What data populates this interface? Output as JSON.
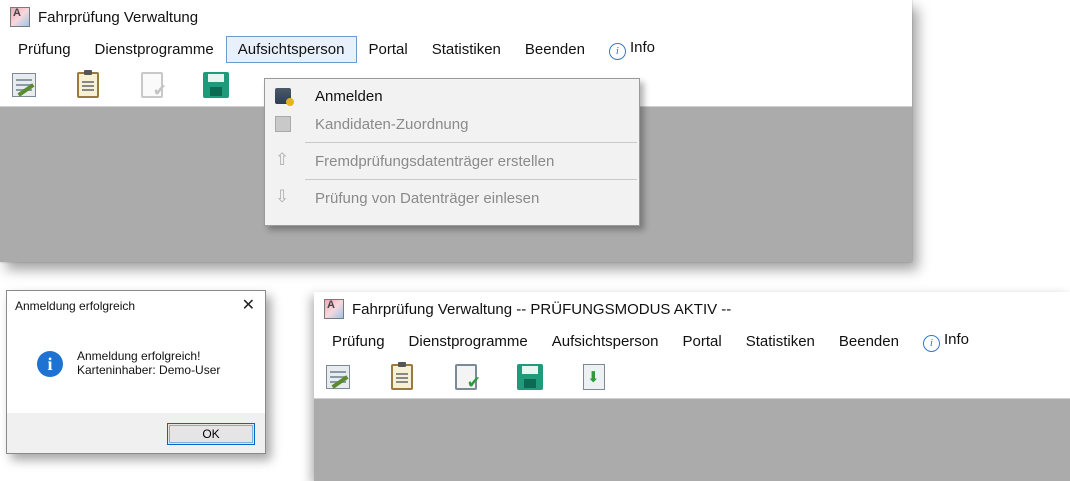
{
  "top_window": {
    "title": "Fahrprüfung Verwaltung",
    "menu": [
      {
        "label": "Prüfung"
      },
      {
        "label": "Dienstprogramme"
      },
      {
        "label": "Aufsichtsperson",
        "active": true
      },
      {
        "label": "Portal"
      },
      {
        "label": "Statistiken"
      },
      {
        "label": "Beenden"
      },
      {
        "label": "Info",
        "icon": "info-icon"
      }
    ],
    "toolbar": [
      {
        "icon": "edit-icon",
        "enabled": true
      },
      {
        "icon": "clipboard-icon",
        "enabled": true
      },
      {
        "icon": "clipboard-check-icon",
        "enabled": false
      },
      {
        "icon": "save-icon",
        "enabled": true
      }
    ],
    "dropdown": [
      {
        "label": "Anmelden",
        "icon": "login-icon",
        "enabled": true
      },
      {
        "label": "Kandidaten-Zuordnung",
        "icon": "assign-icon",
        "enabled": false
      },
      {
        "separator": true
      },
      {
        "label": "Fremdprüfungsdatenträger erstellen",
        "icon": "upload-icon",
        "enabled": false
      },
      {
        "separator": true
      },
      {
        "label": "Prüfung von Datenträger einlesen",
        "icon": "download-icon",
        "enabled": false
      }
    ]
  },
  "dialog": {
    "title": "Anmeldung erfolgreich",
    "close_symbol": "✕",
    "icon_symbol": "i",
    "message_line1": "Anmeldung erfolgreich!",
    "message_line2": "Karteninhaber: Demo-User",
    "ok_label": "OK"
  },
  "bottom_window": {
    "title": "Fahrprüfung Verwaltung -- PRÜFUNGSMODUS AKTIV --",
    "menu": [
      {
        "label": "Prüfung"
      },
      {
        "label": "Dienstprogramme"
      },
      {
        "label": "Aufsichtsperson"
      },
      {
        "label": "Portal"
      },
      {
        "label": "Statistiken"
      },
      {
        "label": "Beenden"
      },
      {
        "label": "Info",
        "icon": "info-icon"
      }
    ],
    "toolbar": [
      {
        "icon": "edit-icon",
        "enabled": true
      },
      {
        "icon": "clipboard-icon",
        "enabled": true
      },
      {
        "icon": "clipboard-check-icon",
        "enabled": true
      },
      {
        "icon": "save-icon",
        "enabled": true
      },
      {
        "icon": "import-icon",
        "enabled": true
      }
    ]
  },
  "colors": {
    "workspace": "#ababab",
    "menu_active_border": "#6b9bd1",
    "dialog_info_icon": "#1e73d2"
  }
}
